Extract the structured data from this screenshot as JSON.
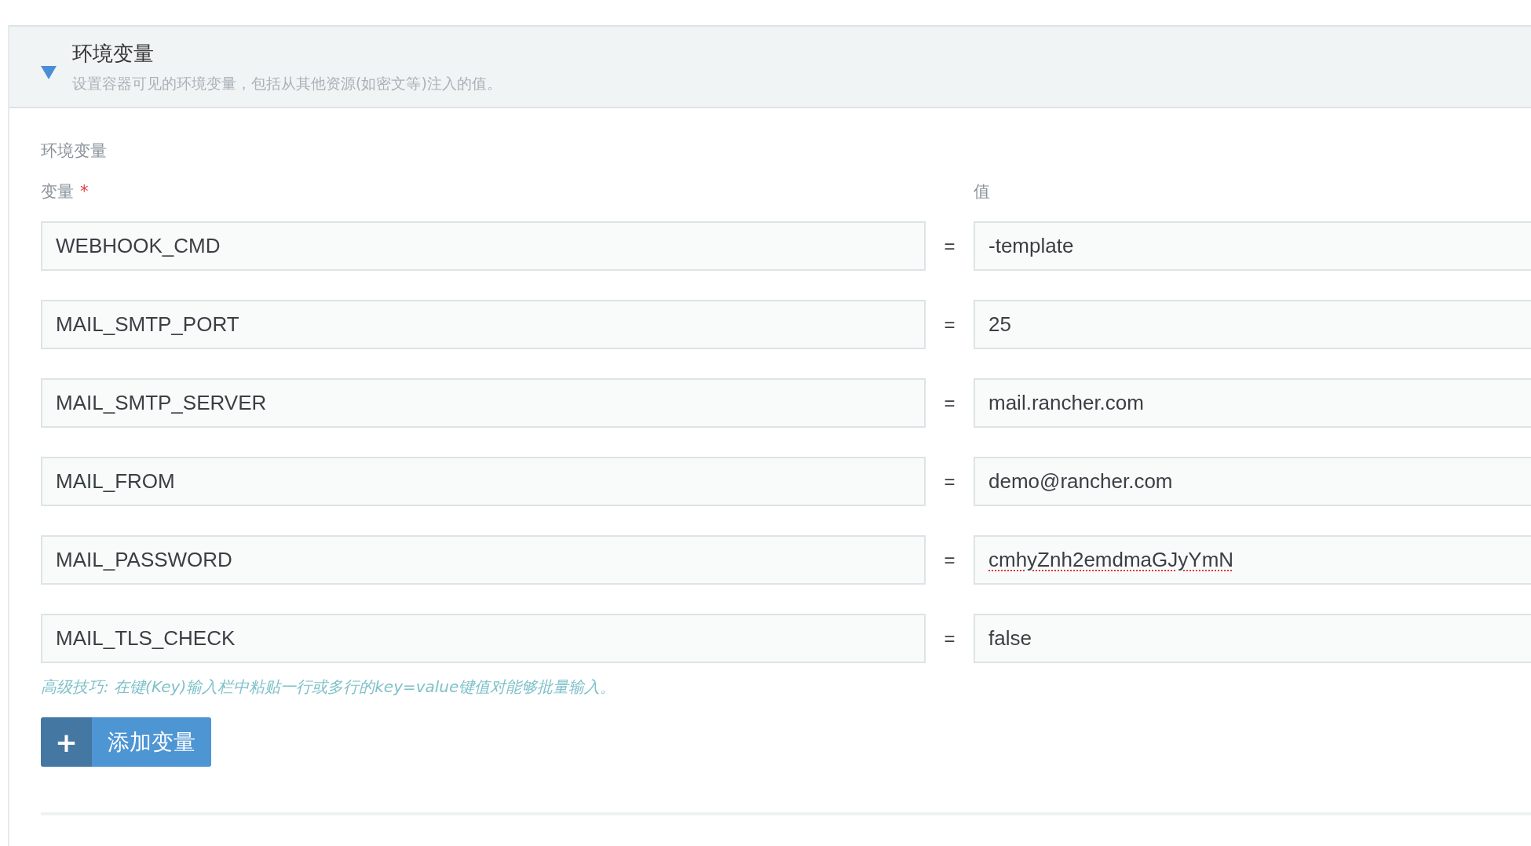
{
  "section": {
    "title": "环境变量",
    "description": "设置容器可见的环境变量，包括从其他资源(如密文等)注入的值。",
    "expanded": true
  },
  "form": {
    "label": "环境变量",
    "key_label": "变量",
    "required_mark": "*",
    "value_label": "值",
    "rows": [
      {
        "key": "WEBHOOK_CMD",
        "separator": "=",
        "value": "-template",
        "misspelled": false
      },
      {
        "key": "MAIL_SMTP_PORT",
        "separator": "=",
        "value": "25",
        "misspelled": false
      },
      {
        "key": "MAIL_SMTP_SERVER",
        "separator": "=",
        "value": "mail.rancher.com",
        "misspelled": false
      },
      {
        "key": "MAIL_FROM",
        "separator": "=",
        "value": "demo@rancher.com",
        "misspelled": false
      },
      {
        "key": "MAIL_PASSWORD",
        "separator": "=",
        "value": "cmhyZnh2emdmaGJyYmN",
        "misspelled": true
      },
      {
        "key": "MAIL_TLS_CHECK",
        "separator": "=",
        "value": "false",
        "misspelled": false
      }
    ],
    "hint": "高级技巧: 在键(Key)输入栏中粘贴一行或多行的key=value键值对能够批量输入。",
    "add_button": {
      "icon": "+",
      "label": "添加变量"
    }
  }
}
